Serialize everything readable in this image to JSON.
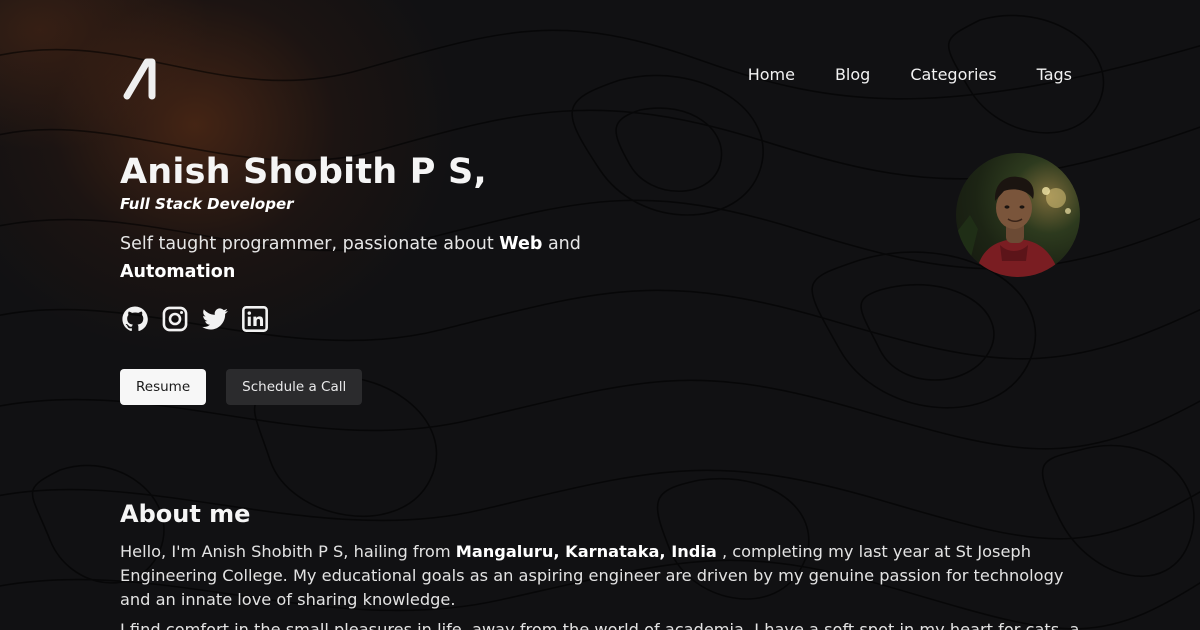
{
  "nav": {
    "items": [
      "Home",
      "Blog",
      "Categories",
      "Tags"
    ]
  },
  "hero": {
    "name": "Anish Shobith P S,",
    "role": "Full Stack Developer",
    "tagline_pre": "Self taught programmer, passionate about ",
    "tagline_b1": "Web",
    "tagline_mid": " and ",
    "tagline_b2": "Automation",
    "socials": [
      "github-icon",
      "instagram-icon",
      "twitter-icon",
      "linkedin-icon"
    ],
    "resume_label": "Resume",
    "schedule_label": "Schedule a Call"
  },
  "about": {
    "title": "About me",
    "p1_pre": "Hello, I'm Anish Shobith P S, hailing from ",
    "p1_bold": "Mangaluru, Karnataka, India",
    "p1_post": " , completing my last year at St Joseph Engineering College. My educational goals as an aspiring engineer are driven by my genuine passion for technology and an innate love of sharing knowledge.",
    "p2": "I find comfort in the small pleasures in life, away from the world of academia. I have a soft spot in my heart for cats, and"
  },
  "colors": {
    "background": "#111113",
    "accent_glow": "#6e3416",
    "button_light": "#f7f7f7",
    "button_dark": "#2b2b2d"
  }
}
